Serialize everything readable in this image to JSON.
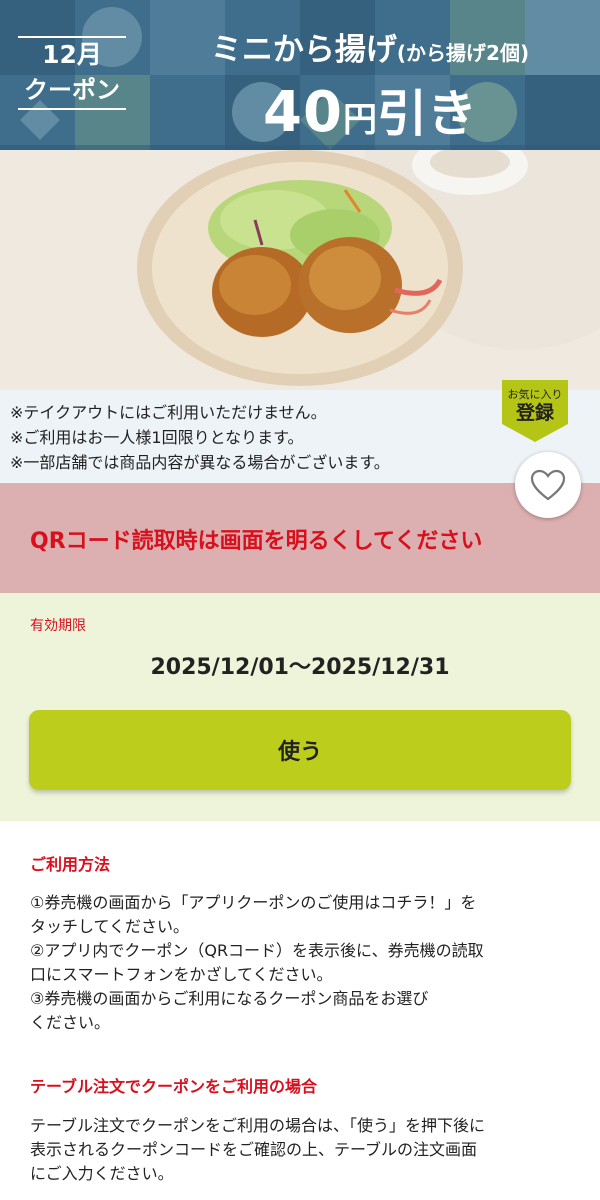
{
  "header": {
    "month_label": "12月",
    "coupon_label": "クーポン",
    "title_main": "ミニから揚げ",
    "title_sub": "(から揚げ2個)",
    "discount_value": "40",
    "discount_unit": "円",
    "discount_text": "引き"
  },
  "notes": [
    "※テイクアウトにはご利用いただけません。",
    "※ご利用はお一人様1回限りとなります。",
    "※一部店舗では商品内容が異なる場合がございます。"
  ],
  "favorite": {
    "line1": "お気に入り",
    "line2": "登録",
    "icon": "heart-icon"
  },
  "qr_warning": "QRコード読取時は画面を明るくしてください",
  "validity": {
    "label": "有効期限",
    "dates": "2025/12/01～2025/12/31"
  },
  "use_button": "使う",
  "howto": {
    "title": "ご利用方法",
    "steps": [
      "①券売機の画面から「アプリクーポンのご使用はコチラ！」を",
      "タッチしてください。",
      "②アプリ内でクーポン（QRコード）を表示後に、券売機の読取",
      "口にスマートフォンをかざしてください。",
      "③券売機の画面からご利用になるクーポン商品をお選び",
      "ください。"
    ]
  },
  "table_order": {
    "title": "テーブル注文でクーポンをご利用の場合",
    "lines": [
      "テーブル注文でクーポンをご利用の場合は、「使う」を押下後に",
      "表示されるクーポンコードをご確認の上、テーブルの注文画面",
      "にご入力ください。"
    ]
  },
  "colors": {
    "accent_red": "#d8101e",
    "use_button": "#bccd1c",
    "warning_bg": "#dcb0b0",
    "validity_bg": "#eef4da",
    "notes_bg": "#eef3f8",
    "header_band": "#3f6d8c"
  }
}
